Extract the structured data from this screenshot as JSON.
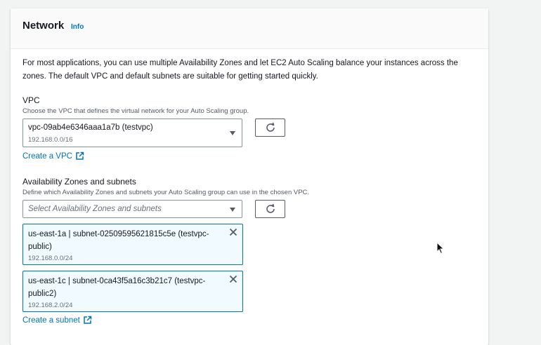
{
  "network": {
    "title": "Network",
    "info_label": "Info",
    "intro": "For most applications, you can use multiple Availability Zones and let EC2 Auto Scaling balance your instances across the zones. The default VPC and default subnets are suitable for getting started quickly."
  },
  "vpc": {
    "label": "VPC",
    "description": "Choose the VPC that defines the virtual network for your Auto Scaling group.",
    "selected_value": "vpc-09ab4e6346aaa1a7b (testvpc)",
    "selected_cidr": "192.168.0.0/16",
    "create_link": "Create a VPC"
  },
  "subnets": {
    "label": "Availability Zones and subnets",
    "description": "Define which Availability Zones and subnets your Auto Scaling group can use in the chosen VPC.",
    "placeholder": "Select Availability Zones and subnets",
    "tokens": [
      {
        "label": "us-east-1a | subnet-02509595621815c5e (testvpc-public)",
        "cidr": "192.168.0.0/24"
      },
      {
        "label": "us-east-1c | subnet-0ca43f5a16c3b21c7 (testvpc-public2)",
        "cidr": "192.168.2.0/24"
      }
    ],
    "create_link": "Create a subnet"
  },
  "colors": {
    "link": "#0073bb",
    "token_bg": "#f1faff",
    "token_border": "#0073bb"
  },
  "icons": [
    "refresh-icon",
    "caret-down-icon",
    "external-link-icon",
    "close-icon",
    "mouse-cursor-icon"
  ]
}
